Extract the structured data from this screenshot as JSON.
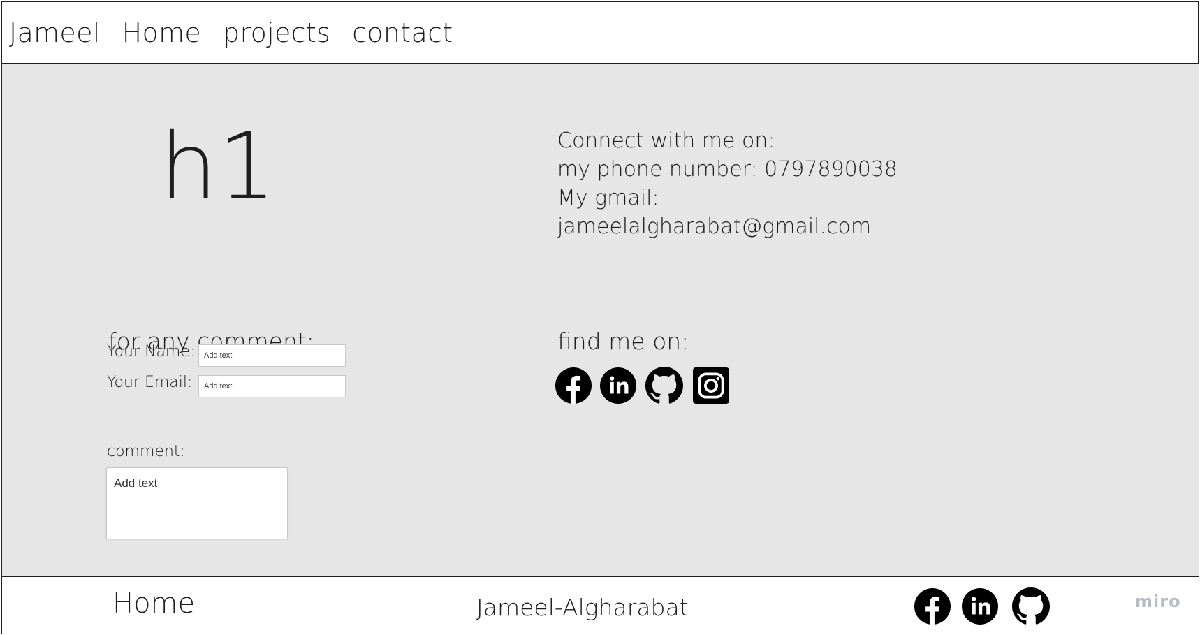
{
  "nav": {
    "brand": "Jameel",
    "links": [
      "Home",
      "projects",
      "contact"
    ]
  },
  "hero": {
    "heading": "h1"
  },
  "contact": {
    "title": "Connect with me on:",
    "phone": "my phone number: 0797890038",
    "gmail_label": "My gmail:",
    "email": "jameelalgharabat@gmail.com"
  },
  "comment_form": {
    "title": "for any comment:",
    "name_label": "Your Name:",
    "name_placeholder": "Add text",
    "email_label": "Your Email:",
    "email_placeholder": "Add text",
    "comment_label": "comment:",
    "comment_placeholder": "Add text"
  },
  "social": {
    "title": "find me on:",
    "icons": [
      "facebook-icon",
      "linkedin-icon",
      "github-icon",
      "instagram-icon"
    ]
  },
  "footer": {
    "home": "Home",
    "name": "Jameel-Algharabat",
    "icons": [
      "facebook-icon",
      "linkedin-icon",
      "github-icon"
    ],
    "watermark": "miro"
  },
  "colors": {
    "text": "#1e1e1e",
    "main_bg": "#e6e6e6",
    "icon": "#000000",
    "watermark": "#b8bcc6"
  }
}
